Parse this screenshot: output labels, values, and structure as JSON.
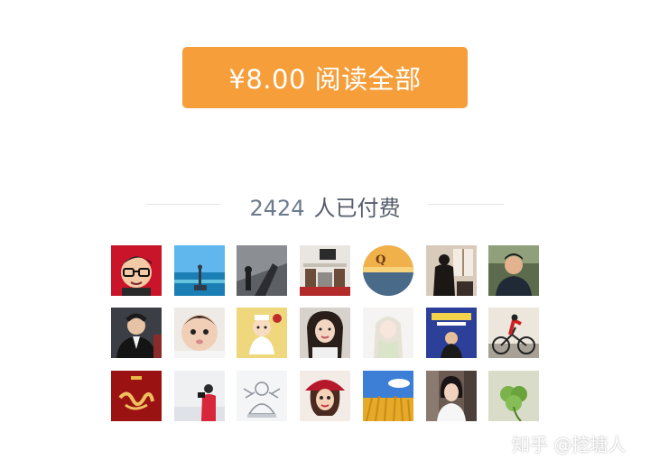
{
  "purchase": {
    "button_label": "¥8.00 阅读全部"
  },
  "paid": {
    "count": "2424",
    "suffix": "人已付费"
  },
  "avatars": [
    {
      "name": "avatar-cartoon-glasses"
    },
    {
      "name": "avatar-sea-statue"
    },
    {
      "name": "avatar-dark-street"
    },
    {
      "name": "avatar-studio-room"
    },
    {
      "name": "avatar-q-sunset-logo"
    },
    {
      "name": "avatar-window-silhouette"
    },
    {
      "name": "avatar-man-outdoors"
    },
    {
      "name": "avatar-man-suit"
    },
    {
      "name": "avatar-baby"
    },
    {
      "name": "avatar-cartoon-chef"
    },
    {
      "name": "avatar-woman-selfie"
    },
    {
      "name": "avatar-anime-girl"
    },
    {
      "name": "avatar-design-poster"
    },
    {
      "name": "avatar-cyclist"
    },
    {
      "name": "avatar-red-calligraphy"
    },
    {
      "name": "avatar-photographer-snow"
    },
    {
      "name": "avatar-buddha-sketch"
    },
    {
      "name": "avatar-cartoon-woman-red-hat"
    },
    {
      "name": "avatar-wheat-field"
    },
    {
      "name": "avatar-woman-doctor"
    },
    {
      "name": "avatar-clover-leaf"
    }
  ],
  "watermark": {
    "text": "知乎 @挖塘人"
  }
}
